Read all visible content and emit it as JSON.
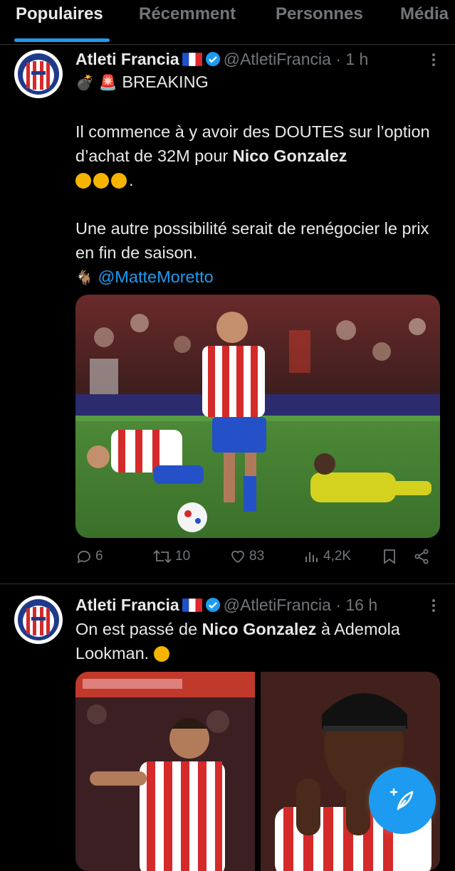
{
  "tabs": [
    "Populaires",
    "Récemment",
    "Personnes",
    "Média"
  ],
  "tweets": [
    {
      "name": "Atleti Francia",
      "handle": "@AtletiFrancia",
      "time": "· 1 h",
      "breaking": "BREAKING",
      "line1a": "Il commence à y avoir des DOUTES sur l’option d’achat de 32M pour ",
      "line1b": "Nico Gonzalez",
      "line1c": ".",
      "line2": "Une autre possibilité serait de renégocier le prix en fin de saison.",
      "mention": "@MatteMoretto",
      "replies": "6",
      "retweets": "10",
      "likes": "83",
      "views": "4,2K"
    },
    {
      "name": "Atleti Francia",
      "handle": "@AtletiFrancia",
      "time": "· 16 h",
      "texta": "On est passé de ",
      "textb": "Nico Gonzalez",
      "textc": " à Ademola Lookman."
    }
  ],
  "colors": {
    "accent": "#1d9bf0",
    "muted": "#71767b",
    "text": "#e7e9ea",
    "separator": "#2f3336"
  }
}
